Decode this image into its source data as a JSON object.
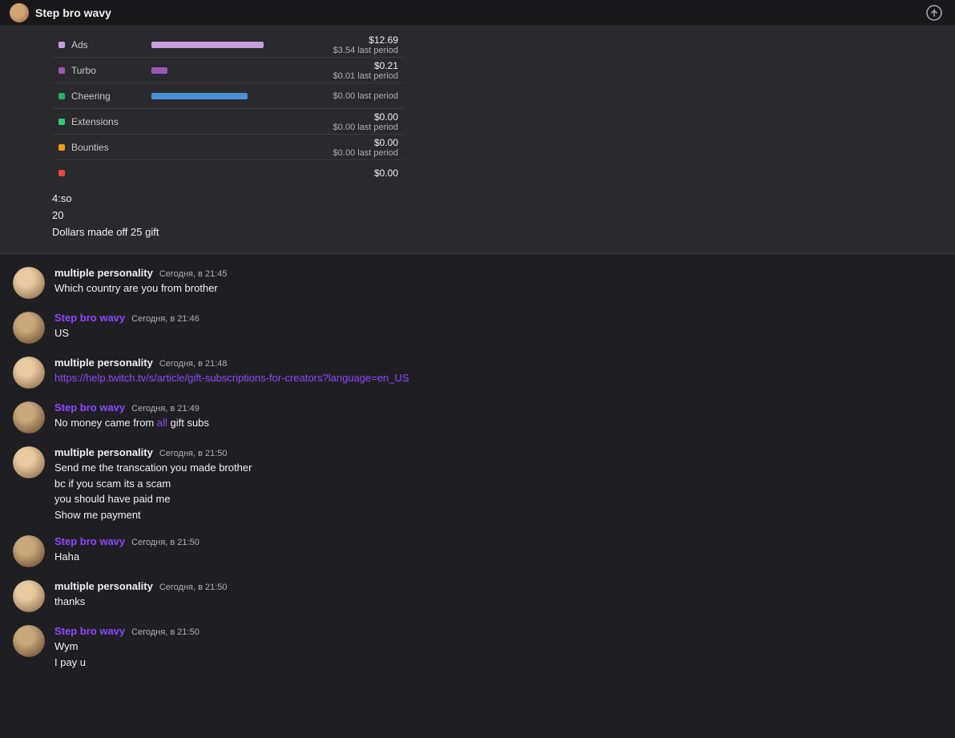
{
  "header": {
    "title": "Step bro wavy",
    "avatar_alt": "SBW"
  },
  "revenue": {
    "rows": [
      {
        "label": "Ads",
        "dot_color": "#c8a0e0",
        "bar_color": "#c8a0e0",
        "bar_width": "70%",
        "main": "$12.69",
        "sub": "$3.54 last period"
      },
      {
        "label": "Turbo",
        "dot_color": "#9b59b6",
        "bar_color": "#9b59b6",
        "bar_width": "10%",
        "main": "$0.21",
        "sub": "$0.01 last period"
      },
      {
        "label": "Cheering",
        "dot_color": "#27ae60",
        "bar_color": "#4a90d9",
        "bar_width": "60%",
        "main": "",
        "sub": "$0.00 last period"
      },
      {
        "label": "Extensions",
        "dot_color": "#2ecc71",
        "bar_color": "#2ecc71",
        "bar_width": "0%",
        "main": "$0.00",
        "sub": "$0.00 last period"
      },
      {
        "label": "Bounties",
        "dot_color": "#f39c12",
        "bar_color": "#f39c12",
        "bar_width": "0%",
        "main": "$0.00",
        "sub": "$0.00 last period"
      },
      {
        "label": "",
        "dot_color": "#e74c3c",
        "bar_color": "#e74c3c",
        "bar_width": "0%",
        "main": "$0.00",
        "sub": ""
      }
    ],
    "stat1": "4:so",
    "stat2": "20",
    "stat3": "Dollars made off 25 gift"
  },
  "messages": [
    {
      "id": "msg1",
      "username": "multiple personality",
      "username_type": "mp",
      "timestamp": "Сегодня, в 21:45",
      "lines": [
        {
          "text": "Which country are you from brother",
          "type": "plain"
        }
      ]
    },
    {
      "id": "msg2",
      "username": "Step bro wavy",
      "username_type": "sbw",
      "timestamp": "Сегодня, в 21:46",
      "lines": [
        {
          "text": "US",
          "type": "plain"
        }
      ]
    },
    {
      "id": "msg3",
      "username": "multiple personality",
      "username_type": "mp",
      "timestamp": "Сегодня, в 21:48",
      "lines": [
        {
          "text": "https://help.twitch.tv/s/article/gift-subscriptions-for-creators?language=en_US",
          "type": "link"
        }
      ]
    },
    {
      "id": "msg4",
      "username": "Step bro wavy",
      "username_type": "sbw",
      "timestamp": "Сегодня, в 21:49",
      "lines": [
        {
          "text": "No money came from ",
          "highlight": "all",
          "rest": " gift subs",
          "type": "highlight"
        }
      ]
    },
    {
      "id": "msg5",
      "username": "multiple personality",
      "username_type": "mp",
      "timestamp": "Сегодня, в 21:50",
      "lines": [
        {
          "text": "Send me the transcation you made brother",
          "type": "plain"
        },
        {
          "text": "bc if you scam its a scam",
          "type": "plain"
        },
        {
          "text": "you should have paid me",
          "type": "plain"
        },
        {
          "text": "Show me payment",
          "type": "plain"
        }
      ]
    },
    {
      "id": "msg6",
      "username": "Step bro wavy",
      "username_type": "sbw",
      "timestamp": "Сегодня, в 21:50",
      "lines": [
        {
          "text": "Haha",
          "type": "plain"
        }
      ]
    },
    {
      "id": "msg7",
      "username": "multiple personality",
      "username_type": "mp",
      "timestamp": "Сегодня, в 21:50",
      "lines": [
        {
          "text": "thanks",
          "type": "plain"
        }
      ]
    },
    {
      "id": "msg8",
      "username": "Step bro wavy",
      "username_type": "sbw",
      "timestamp": "Сегодня, в 21:50",
      "lines": [
        {
          "text": "Wym",
          "type": "plain"
        },
        {
          "text": "I pay u",
          "type": "plain"
        }
      ]
    }
  ]
}
